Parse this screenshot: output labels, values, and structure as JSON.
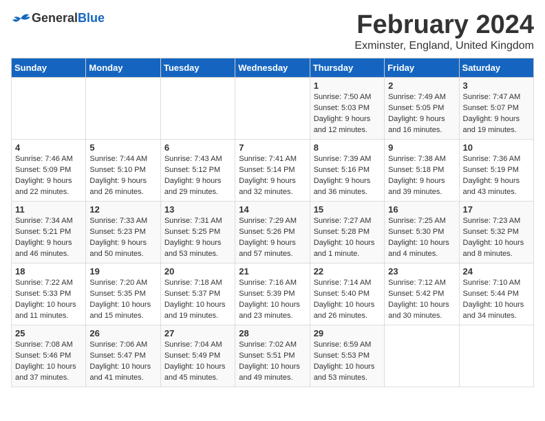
{
  "header": {
    "logo_general": "General",
    "logo_blue": "Blue",
    "title": "February 2024",
    "subtitle": "Exminster, England, United Kingdom"
  },
  "weekdays": [
    "Sunday",
    "Monday",
    "Tuesday",
    "Wednesday",
    "Thursday",
    "Friday",
    "Saturday"
  ],
  "weeks": [
    [
      {
        "day": "",
        "info": ""
      },
      {
        "day": "",
        "info": ""
      },
      {
        "day": "",
        "info": ""
      },
      {
        "day": "",
        "info": ""
      },
      {
        "day": "1",
        "info": "Sunrise: 7:50 AM\nSunset: 5:03 PM\nDaylight: 9 hours\nand 12 minutes."
      },
      {
        "day": "2",
        "info": "Sunrise: 7:49 AM\nSunset: 5:05 PM\nDaylight: 9 hours\nand 16 minutes."
      },
      {
        "day": "3",
        "info": "Sunrise: 7:47 AM\nSunset: 5:07 PM\nDaylight: 9 hours\nand 19 minutes."
      }
    ],
    [
      {
        "day": "4",
        "info": "Sunrise: 7:46 AM\nSunset: 5:09 PM\nDaylight: 9 hours\nand 22 minutes."
      },
      {
        "day": "5",
        "info": "Sunrise: 7:44 AM\nSunset: 5:10 PM\nDaylight: 9 hours\nand 26 minutes."
      },
      {
        "day": "6",
        "info": "Sunrise: 7:43 AM\nSunset: 5:12 PM\nDaylight: 9 hours\nand 29 minutes."
      },
      {
        "day": "7",
        "info": "Sunrise: 7:41 AM\nSunset: 5:14 PM\nDaylight: 9 hours\nand 32 minutes."
      },
      {
        "day": "8",
        "info": "Sunrise: 7:39 AM\nSunset: 5:16 PM\nDaylight: 9 hours\nand 36 minutes."
      },
      {
        "day": "9",
        "info": "Sunrise: 7:38 AM\nSunset: 5:18 PM\nDaylight: 9 hours\nand 39 minutes."
      },
      {
        "day": "10",
        "info": "Sunrise: 7:36 AM\nSunset: 5:19 PM\nDaylight: 9 hours\nand 43 minutes."
      }
    ],
    [
      {
        "day": "11",
        "info": "Sunrise: 7:34 AM\nSunset: 5:21 PM\nDaylight: 9 hours\nand 46 minutes."
      },
      {
        "day": "12",
        "info": "Sunrise: 7:33 AM\nSunset: 5:23 PM\nDaylight: 9 hours\nand 50 minutes."
      },
      {
        "day": "13",
        "info": "Sunrise: 7:31 AM\nSunset: 5:25 PM\nDaylight: 9 hours\nand 53 minutes."
      },
      {
        "day": "14",
        "info": "Sunrise: 7:29 AM\nSunset: 5:26 PM\nDaylight: 9 hours\nand 57 minutes."
      },
      {
        "day": "15",
        "info": "Sunrise: 7:27 AM\nSunset: 5:28 PM\nDaylight: 10 hours\nand 1 minute."
      },
      {
        "day": "16",
        "info": "Sunrise: 7:25 AM\nSunset: 5:30 PM\nDaylight: 10 hours\nand 4 minutes."
      },
      {
        "day": "17",
        "info": "Sunrise: 7:23 AM\nSunset: 5:32 PM\nDaylight: 10 hours\nand 8 minutes."
      }
    ],
    [
      {
        "day": "18",
        "info": "Sunrise: 7:22 AM\nSunset: 5:33 PM\nDaylight: 10 hours\nand 11 minutes."
      },
      {
        "day": "19",
        "info": "Sunrise: 7:20 AM\nSunset: 5:35 PM\nDaylight: 10 hours\nand 15 minutes."
      },
      {
        "day": "20",
        "info": "Sunrise: 7:18 AM\nSunset: 5:37 PM\nDaylight: 10 hours\nand 19 minutes."
      },
      {
        "day": "21",
        "info": "Sunrise: 7:16 AM\nSunset: 5:39 PM\nDaylight: 10 hours\nand 23 minutes."
      },
      {
        "day": "22",
        "info": "Sunrise: 7:14 AM\nSunset: 5:40 PM\nDaylight: 10 hours\nand 26 minutes."
      },
      {
        "day": "23",
        "info": "Sunrise: 7:12 AM\nSunset: 5:42 PM\nDaylight: 10 hours\nand 30 minutes."
      },
      {
        "day": "24",
        "info": "Sunrise: 7:10 AM\nSunset: 5:44 PM\nDaylight: 10 hours\nand 34 minutes."
      }
    ],
    [
      {
        "day": "25",
        "info": "Sunrise: 7:08 AM\nSunset: 5:46 PM\nDaylight: 10 hours\nand 37 minutes."
      },
      {
        "day": "26",
        "info": "Sunrise: 7:06 AM\nSunset: 5:47 PM\nDaylight: 10 hours\nand 41 minutes."
      },
      {
        "day": "27",
        "info": "Sunrise: 7:04 AM\nSunset: 5:49 PM\nDaylight: 10 hours\nand 45 minutes."
      },
      {
        "day": "28",
        "info": "Sunrise: 7:02 AM\nSunset: 5:51 PM\nDaylight: 10 hours\nand 49 minutes."
      },
      {
        "day": "29",
        "info": "Sunrise: 6:59 AM\nSunset: 5:53 PM\nDaylight: 10 hours\nand 53 minutes."
      },
      {
        "day": "",
        "info": ""
      },
      {
        "day": "",
        "info": ""
      }
    ]
  ]
}
